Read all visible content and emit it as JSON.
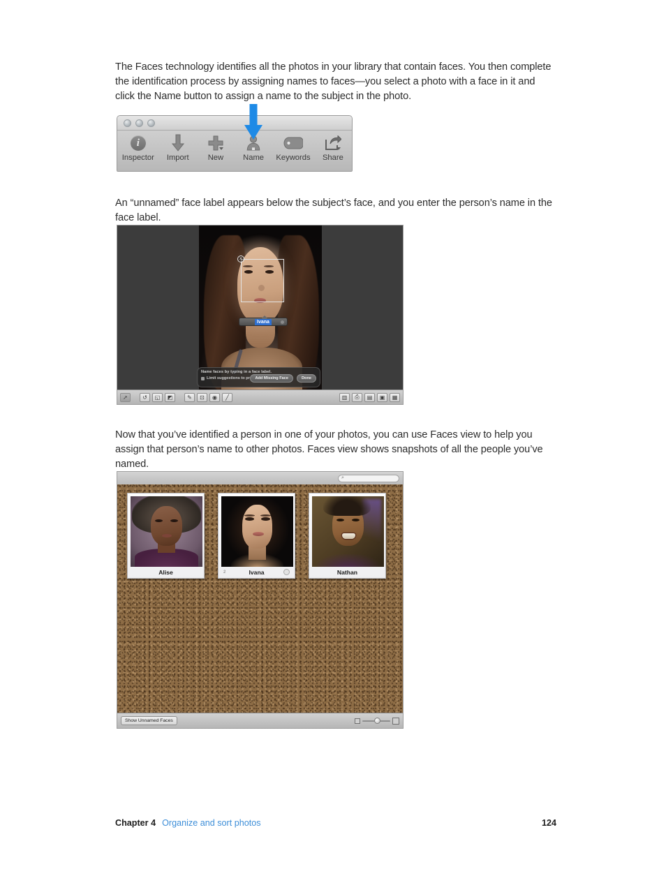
{
  "paragraphs": {
    "p1": "The Faces technology identifies all the photos in your library that contain faces. You then complete the identification process by assigning names to faces—you select a photo with a face in it and click the Name button to assign a name to the subject in the photo.",
    "p2": "An “unnamed” face label appears below the subject’s face, and you enter the person’s name in the face label.",
    "p3": "Now that you’ve identified a person in one of your photos, you can use Faces view to help you assign that person’s name to other photos. Faces view shows snapshots of all the people you’ve named."
  },
  "toolbar_figure": {
    "window_controls": [
      "close",
      "minimize",
      "zoom"
    ],
    "items": [
      {
        "label": "Inspector",
        "icon": "info-circle-icon",
        "has_caret": false
      },
      {
        "label": "Import",
        "icon": "down-arrow-icon",
        "has_caret": false
      },
      {
        "label": "New",
        "icon": "plus-icon",
        "has_caret": true
      },
      {
        "label": "Name",
        "icon": "person-silhouette-icon",
        "has_caret": false
      },
      {
        "label": "Keywords",
        "icon": "tag-icon",
        "has_caret": false
      },
      {
        "label": "Share",
        "icon": "share-export-icon",
        "has_caret": true
      }
    ],
    "callout": {
      "icon": "blue-down-arrow-icon",
      "points_to": "Name",
      "color": "#1e8ae6"
    }
  },
  "photo_figure": {
    "face_label": {
      "value": "Ivana",
      "selected": true,
      "close_icon": "close-circle-icon"
    },
    "face_box_close_icon": "close-circle-icon",
    "hud": {
      "instruction": "Name faces by typing in a face label.",
      "checkbox_label": "Limit suggestions to project",
      "checkbox_checked": true,
      "buttons": [
        "Add Missing Face",
        "Done"
      ]
    },
    "toolbar_left_icons": [
      "arrow-select-icon",
      "rotate-left-icon",
      "straighten-icon",
      "flip-icon",
      "retouch-icon",
      "crop-icon",
      "red-eye-icon",
      "adjust-icon"
    ],
    "toolbar_right_icons": [
      "camera-info-icon",
      "print-icon",
      "metadata-icon",
      "fullscreen-icon",
      "panel-icon"
    ]
  },
  "faces_figure": {
    "search": {
      "placeholder": "",
      "icon": "search-icon"
    },
    "snapshots": [
      {
        "name": "Alise",
        "badge_left": "",
        "badge_right": ""
      },
      {
        "name": "Ivana",
        "badge_left": "2",
        "badge_right": "info-circle-icon"
      },
      {
        "name": "Nathan",
        "badge_left": "",
        "badge_right": ""
      }
    ],
    "bottom": {
      "show_unnamed_label": "Show Unnamed Faces",
      "zoom_small_icon": "small-thumbnail-icon",
      "zoom_large_icon": "large-thumbnail-icon"
    }
  },
  "footer": {
    "chapter": "Chapter 4",
    "section": "Organize and sort photos",
    "page": "124",
    "link_color": "#3d8ed8"
  }
}
